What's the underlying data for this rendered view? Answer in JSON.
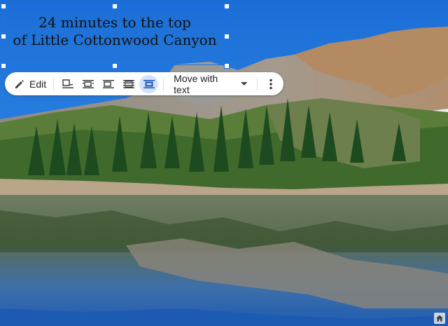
{
  "caption": {
    "line1": "24 minutes to the top",
    "line2": "of Little Cottonwood Canyon"
  },
  "toolbar": {
    "edit_label": "Edit",
    "move_label": "Move with text",
    "wrap_options": [
      {
        "name": "inline",
        "selected": false
      },
      {
        "name": "wrap-text",
        "selected": false
      },
      {
        "name": "break-text",
        "selected": false
      },
      {
        "name": "behind-text",
        "selected": false
      },
      {
        "name": "in-front-of-text",
        "selected": true
      }
    ]
  },
  "colors": {
    "accent": "#1a73e8",
    "selected_bg": "#d3e3fd"
  },
  "icons": [
    "pencil-icon",
    "inline-icon",
    "wrap-text-icon",
    "break-text-icon",
    "behind-text-icon",
    "in-front-of-text-icon",
    "caret-down-icon",
    "more-vert-icon",
    "home-icon"
  ]
}
